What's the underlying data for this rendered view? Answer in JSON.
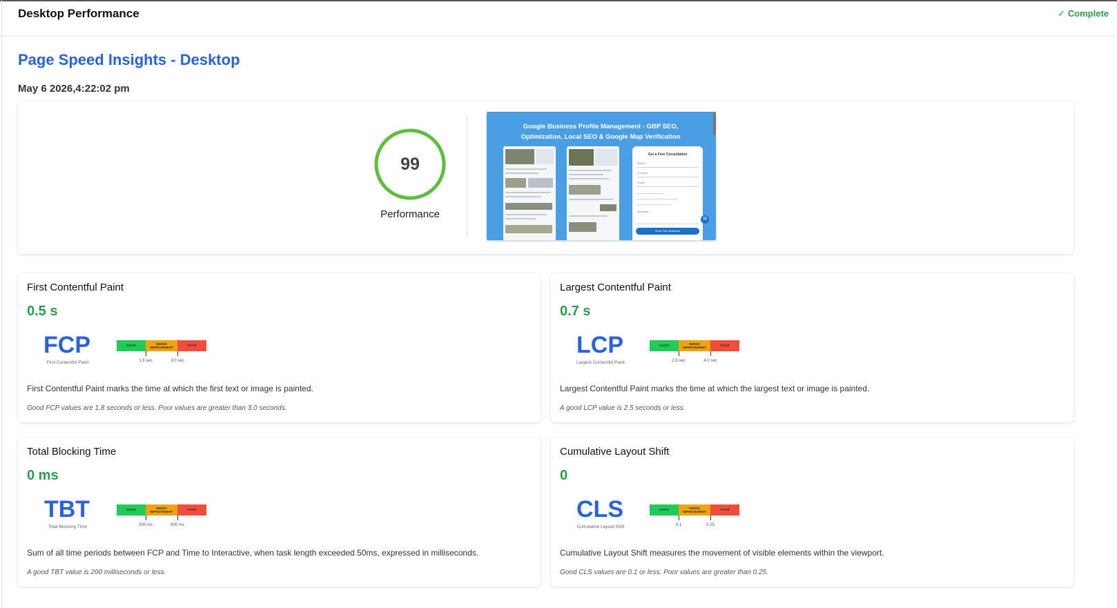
{
  "header": {
    "title": "Desktop Performance",
    "status": "✓ Complete"
  },
  "page": {
    "title": "Page Speed Insights - Desktop",
    "timestamp": "May 6 2026,4:22:02 pm"
  },
  "summary": {
    "score": "99",
    "score_value": 99,
    "score_label": "Performance",
    "score_color": "#5cbd3f",
    "screenshot": {
      "headline_line1": "Google Business Profile Management - GBP SEO,",
      "headline_line2": "Optimization, Local SEO & Google Map Verification",
      "form_title": "Get a Free Consultation",
      "form_fields": [
        "Name*",
        "Contact*",
        "Email*",
        "Message*"
      ],
      "form_button": "Grow Your Business"
    }
  },
  "scale_labels": {
    "good": "GOOD",
    "needs_1": "NEEDS",
    "needs_2": "IMPROVEMENT",
    "poor": "POOR"
  },
  "colors": {
    "good": "#1fcc5a",
    "needs_improvement": "#f2a20d",
    "poor": "#f14c3c",
    "value_green": "#2e9b4e",
    "accent_blue": "#2962d9"
  },
  "metrics": {
    "fcp": {
      "title": "First Contentful Paint",
      "value": "0.5 s",
      "abbr": "FCP",
      "abbr_sub": "First Contentful Paint",
      "threshold_1": "1.8 sec",
      "threshold_2": "3.0 sec",
      "description": "First Contentful Paint marks the time at which the first text or image is painted.",
      "note": "Good FCP values are 1.8 seconds or less. Poor values are greater than 3.0 seconds."
    },
    "lcp": {
      "title": "Largest Contentful Paint",
      "value": "0.7 s",
      "abbr": "LCP",
      "abbr_sub": "Largest Contentful Paint",
      "threshold_1": "2.5 sec",
      "threshold_2": "4.0 sec",
      "description": "Largest Contentful Paint marks the time at which the largest text or image is painted.",
      "note": "A good LCP value is 2.5 seconds or less."
    },
    "tbt": {
      "title": "Total Blocking Time",
      "value": "0 ms",
      "abbr": "TBT",
      "abbr_sub": "Total Blocking Time",
      "threshold_1": "300 ms",
      "threshold_2": "600 ms",
      "description": "Sum of all time periods between FCP and Time to Interactive, when task length exceeded 50ms, expressed in milliseconds.",
      "note": "A good TBT value is 200 milliseconds or less."
    },
    "cls": {
      "title": "Cumulative Layout Shift",
      "value": "0",
      "abbr": "CLS",
      "abbr_sub": "Cumulative Layout Shift",
      "threshold_1": "0.1",
      "threshold_2": "0.25",
      "description": "Cumulative Layout Shift measures the movement of visible elements within the viewport.",
      "note": "Good CLS values are 0.1 or less. Poor values are greater than 0.25."
    }
  }
}
